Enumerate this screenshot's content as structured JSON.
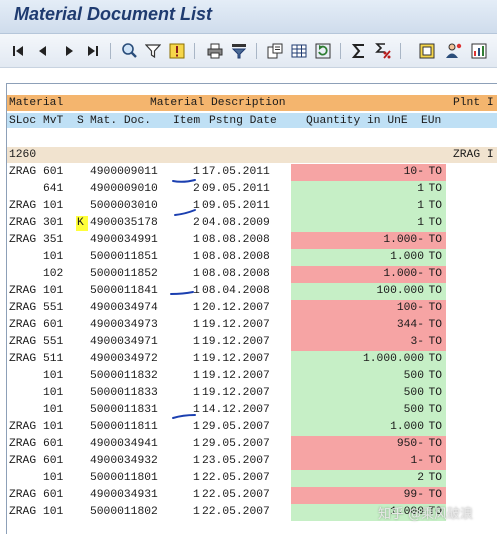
{
  "window": {
    "title": "Material Document List"
  },
  "toolbar": {
    "buttons": [
      {
        "icon": "first-page-icon"
      },
      {
        "icon": "previous-page-icon"
      },
      {
        "icon": "next-page-icon"
      },
      {
        "icon": "last-page-icon"
      },
      {
        "icon": "details-icon"
      },
      {
        "icon": "filter-icon"
      },
      {
        "icon": "choose-icon"
      },
      {
        "icon": "print-icon"
      },
      {
        "icon": "sort-icon"
      },
      {
        "icon": "local-file-icon"
      },
      {
        "icon": "spreadsheet-icon"
      },
      {
        "icon": "refresh-icon"
      },
      {
        "icon": "total-icon"
      },
      {
        "icon": "subtotal-icon"
      },
      {
        "icon": "layout-icon"
      },
      {
        "icon": "change-layout-icon"
      },
      {
        "icon": "graphic-icon"
      }
    ]
  },
  "header": {
    "row1": {
      "material": "Material",
      "description": "Material Description",
      "plant": "Plnt I"
    },
    "row2": {
      "sloc": "SLoc",
      "mvt": "MvT",
      "s": "S",
      "matdoc": "Mat. Doc.",
      "item": "Item",
      "date": "Pstng Date",
      "qty": "Quantity in UnE",
      "eun": "EUn"
    }
  },
  "group": {
    "material": "1260",
    "plant": "ZRAG I"
  },
  "rows": [
    {
      "sloc": "ZRAG",
      "mvt": "601",
      "s": "",
      "doc": "4900009011",
      "item": "1",
      "date": "17.05.2011",
      "qty": "10-",
      "unit": "TO",
      "neg": true
    },
    {
      "sloc": "",
      "mvt": "641",
      "s": "",
      "doc": "4900009010",
      "item": "2",
      "date": "09.05.2011",
      "qty": "1",
      "unit": "TO",
      "neg": false
    },
    {
      "sloc": "ZRAG",
      "mvt": "101",
      "s": "",
      "doc": "5000003010",
      "item": "1",
      "date": "09.05.2011",
      "qty": "1",
      "unit": "TO",
      "neg": false
    },
    {
      "sloc": "ZRAG",
      "mvt": "301",
      "s": "K",
      "doc": "4900035178",
      "item": "2",
      "date": "04.08.2009",
      "qty": "1",
      "unit": "TO",
      "neg": false
    },
    {
      "sloc": "ZRAG",
      "mvt": "351",
      "s": "",
      "doc": "4900034991",
      "item": "1",
      "date": "08.08.2008",
      "qty": "1.000-",
      "unit": "TO",
      "neg": true
    },
    {
      "sloc": "",
      "mvt": "101",
      "s": "",
      "doc": "5000011851",
      "item": "1",
      "date": "08.08.2008",
      "qty": "1.000",
      "unit": "TO",
      "neg": false
    },
    {
      "sloc": "",
      "mvt": "102",
      "s": "",
      "doc": "5000011852",
      "item": "1",
      "date": "08.08.2008",
      "qty": "1.000-",
      "unit": "TO",
      "neg": true
    },
    {
      "sloc": "ZRAG",
      "mvt": "101",
      "s": "",
      "doc": "5000011841",
      "item": "1",
      "date": "08.04.2008",
      "qty": "100.000",
      "unit": "TO",
      "neg": false
    },
    {
      "sloc": "ZRAG",
      "mvt": "551",
      "s": "",
      "doc": "4900034974",
      "item": "1",
      "date": "20.12.2007",
      "qty": "100-",
      "unit": "TO",
      "neg": true
    },
    {
      "sloc": "ZRAG",
      "mvt": "601",
      "s": "",
      "doc": "4900034973",
      "item": "1",
      "date": "19.12.2007",
      "qty": "344-",
      "unit": "TO",
      "neg": true
    },
    {
      "sloc": "ZRAG",
      "mvt": "551",
      "s": "",
      "doc": "4900034971",
      "item": "1",
      "date": "19.12.2007",
      "qty": "3-",
      "unit": "TO",
      "neg": true
    },
    {
      "sloc": "ZRAG",
      "mvt": "511",
      "s": "",
      "doc": "4900034972",
      "item": "1",
      "date": "19.12.2007",
      "qty": "1.000.000",
      "unit": "TO",
      "neg": false
    },
    {
      "sloc": "",
      "mvt": "101",
      "s": "",
      "doc": "5000011832",
      "item": "1",
      "date": "19.12.2007",
      "qty": "500",
      "unit": "TO",
      "neg": false
    },
    {
      "sloc": "",
      "mvt": "101",
      "s": "",
      "doc": "5000011833",
      "item": "1",
      "date": "19.12.2007",
      "qty": "500",
      "unit": "TO",
      "neg": false
    },
    {
      "sloc": "",
      "mvt": "101",
      "s": "",
      "doc": "5000011831",
      "item": "1",
      "date": "14.12.2007",
      "qty": "500",
      "unit": "TO",
      "neg": false
    },
    {
      "sloc": "ZRAG",
      "mvt": "101",
      "s": "",
      "doc": "5000011811",
      "item": "1",
      "date": "29.05.2007",
      "qty": "1.000",
      "unit": "TO",
      "neg": false
    },
    {
      "sloc": "ZRAG",
      "mvt": "601",
      "s": "",
      "doc": "4900034941",
      "item": "1",
      "date": "29.05.2007",
      "qty": "950-",
      "unit": "TO",
      "neg": true
    },
    {
      "sloc": "ZRAG",
      "mvt": "601",
      "s": "",
      "doc": "4900034932",
      "item": "1",
      "date": "23.05.2007",
      "qty": "1-",
      "unit": "TO",
      "neg": true
    },
    {
      "sloc": "",
      "mvt": "101",
      "s": "",
      "doc": "5000011801",
      "item": "1",
      "date": "22.05.2007",
      "qty": "2",
      "unit": "TO",
      "neg": false
    },
    {
      "sloc": "ZRAG",
      "mvt": "601",
      "s": "",
      "doc": "4900034931",
      "item": "1",
      "date": "22.05.2007",
      "qty": "99-",
      "unit": "TO",
      "neg": true
    },
    {
      "sloc": "ZRAG",
      "mvt": "101",
      "s": "",
      "doc": "5000011802",
      "item": "1",
      "date": "22.05.2007",
      "qty": "1.000",
      "unit": "TO",
      "neg": false
    }
  ],
  "watermark": "知乎 @乘风破浪",
  "colors": {
    "header1": "#f4b56e",
    "header2": "#bfe0f5",
    "negative": "#f6a4a4",
    "positive": "#c6efc6",
    "flag": "#ffff3a"
  }
}
